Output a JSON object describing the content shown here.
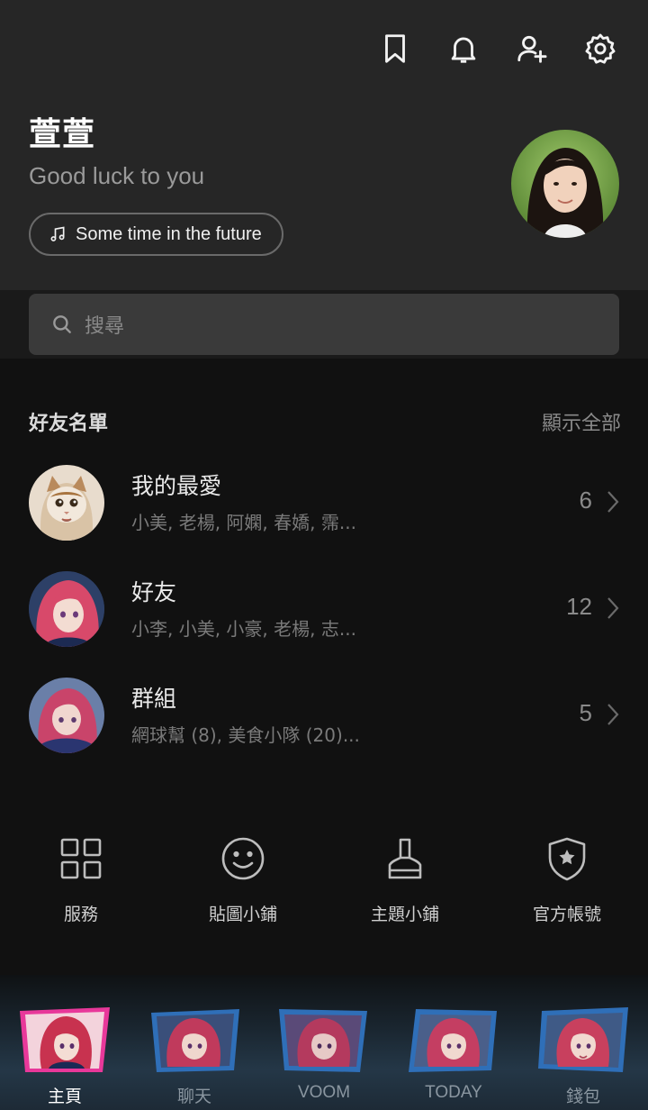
{
  "header": {
    "icons": [
      "bookmark-icon",
      "bell-icon",
      "add-friend-icon",
      "gear-icon"
    ],
    "profile": {
      "name": "萱萱",
      "status": "Good luck to you",
      "music": "Some time in the future"
    }
  },
  "search": {
    "placeholder": "搜尋"
  },
  "friends_section": {
    "title": "好友名單",
    "show_all": "顯示全部",
    "rows": [
      {
        "name": "我的最愛",
        "members": "小美, 老楊, 阿嫻, 春嬌, 霈...",
        "count": "6"
      },
      {
        "name": "好友",
        "members": "小李, 小美, 小豪, 老楊, 志...",
        "count": "12"
      },
      {
        "name": "群組",
        "members": "網球幫 (8), 美食小隊 (20)...",
        "count": "5"
      }
    ]
  },
  "services": [
    {
      "label": "服務",
      "icon": "grid-icon"
    },
    {
      "label": "貼圖小鋪",
      "icon": "smiley-icon"
    },
    {
      "label": "主題小鋪",
      "icon": "brush-icon"
    },
    {
      "label": "官方帳號",
      "icon": "shield-star-icon"
    }
  ],
  "bottom_nav": {
    "active_index": 0,
    "items": [
      {
        "label": "主頁"
      },
      {
        "label": "聊天"
      },
      {
        "label": "VOOM"
      },
      {
        "label": "TODAY"
      },
      {
        "label": "錢包"
      }
    ]
  },
  "colors": {
    "header_bg": "#262626",
    "page_bg": "#111111",
    "search_bg": "#3a3a3a",
    "nav_active_frame": "#e8389a",
    "nav_frame": "#2f6fb8"
  }
}
